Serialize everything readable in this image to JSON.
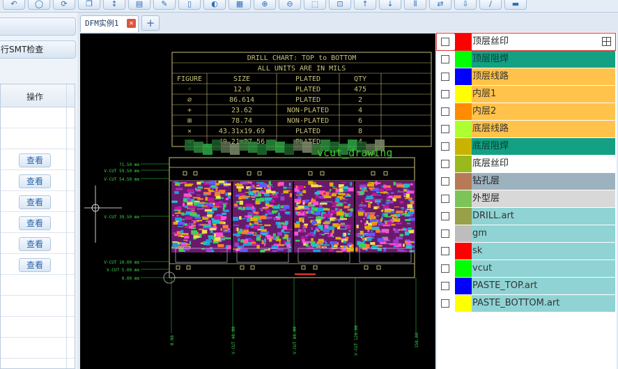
{
  "left_panel": {
    "buttons": [
      "",
      "行SMT检查"
    ],
    "table_header": "操作",
    "view_label": "查看",
    "row_count": 12,
    "view_rows": 6
  },
  "tab": {
    "title": "DFM实例1",
    "close": "✕",
    "add": "+"
  },
  "drill_chart": {
    "title": "DRILL CHART: TOP to BOTTOM",
    "units": "ALL UNITS ARE IN MILS",
    "headers": [
      "FIGURE",
      "SIZE",
      "PLATED",
      "QTY"
    ],
    "rows": [
      [
        "◦",
        "12.0",
        "PLATED",
        "475"
      ],
      [
        "⌀",
        "86.614",
        "PLATED",
        "2"
      ],
      [
        "+",
        "23.62",
        "NON-PLATED",
        "4"
      ],
      [
        "⊞",
        "78.74",
        "NON-PLATED",
        "6"
      ],
      [
        "×",
        "43.31x19.69",
        "PLATED",
        "8"
      ],
      [
        "◇",
        "49.21x27.56",
        "PLATED",
        "4"
      ]
    ]
  },
  "overlay_label": "vcut_drawing",
  "vcut_left": [
    {
      "label": "71.50 mm"
    },
    {
      "label": "V-CUT 59.50 mm"
    },
    {
      "label": "V-CUT 54.50 mm"
    },
    {
      "label": "V-CUT 39.50 mm"
    },
    {
      "label": "V-CUT 10.00 mm"
    },
    {
      "label": "V-CUT 5.00 mm"
    },
    {
      "label": "0.00 mm"
    }
  ],
  "vcut_bottom": [
    "0.00",
    "V-CUT 40.00",
    "V-CUT 80.00",
    "V-CUT 120.00",
    "158.00"
  ],
  "layers": [
    {
      "name": "顶层丝印",
      "color": "#ff0000",
      "bg": "#ffffff",
      "text": "#222222",
      "selected": true
    },
    {
      "name": "顶层阻焊",
      "color": "#00ff00",
      "bg": "#13a083",
      "text": "#0a3a30"
    },
    {
      "name": "顶层线路",
      "color": "#0000ff",
      "bg": "#ffc24a",
      "text": "#333333"
    },
    {
      "name": "内层1",
      "color": "#ffff00",
      "bg": "#ffc24a",
      "text": "#333333"
    },
    {
      "name": "内层2",
      "color": "#ff8c00",
      "bg": "#ffc24a",
      "text": "#333333"
    },
    {
      "name": "底层线路",
      "color": "#adff2f",
      "bg": "#ffc24a",
      "text": "#333333"
    },
    {
      "name": "底层阻焊",
      "color": "#c8b400",
      "bg": "#13a083",
      "text": "#0a3a30"
    },
    {
      "name": "底层丝印",
      "color": "#9ab91c",
      "bg": "#ffffff",
      "text": "#222222"
    },
    {
      "name": "钻孔层",
      "color": "#b87a56",
      "bg": "#9db2bf",
      "text": "#222222"
    },
    {
      "name": "外型层",
      "color": "#7dc458",
      "bg": "#d8d8d8",
      "text": "#222222"
    },
    {
      "name": "DRILL.art",
      "color": "#98a048",
      "bg": "#8fd3d4",
      "text": "#333333"
    },
    {
      "name": "gm",
      "color": "#bdbdbd",
      "bg": "#8fd3d4",
      "text": "#333333"
    },
    {
      "name": "sk",
      "color": "#ff0000",
      "bg": "#8fd3d4",
      "text": "#333333"
    },
    {
      "name": "vcut",
      "color": "#00ff00",
      "bg": "#8fd3d4",
      "text": "#333333"
    },
    {
      "name": "PASTE_TOP.art",
      "color": "#0000ff",
      "bg": "#8fd3d4",
      "text": "#333333"
    },
    {
      "name": "PASTE_BOTTOM.art",
      "color": "#ffff00",
      "bg": "#8fd3d4",
      "text": "#333333"
    }
  ]
}
